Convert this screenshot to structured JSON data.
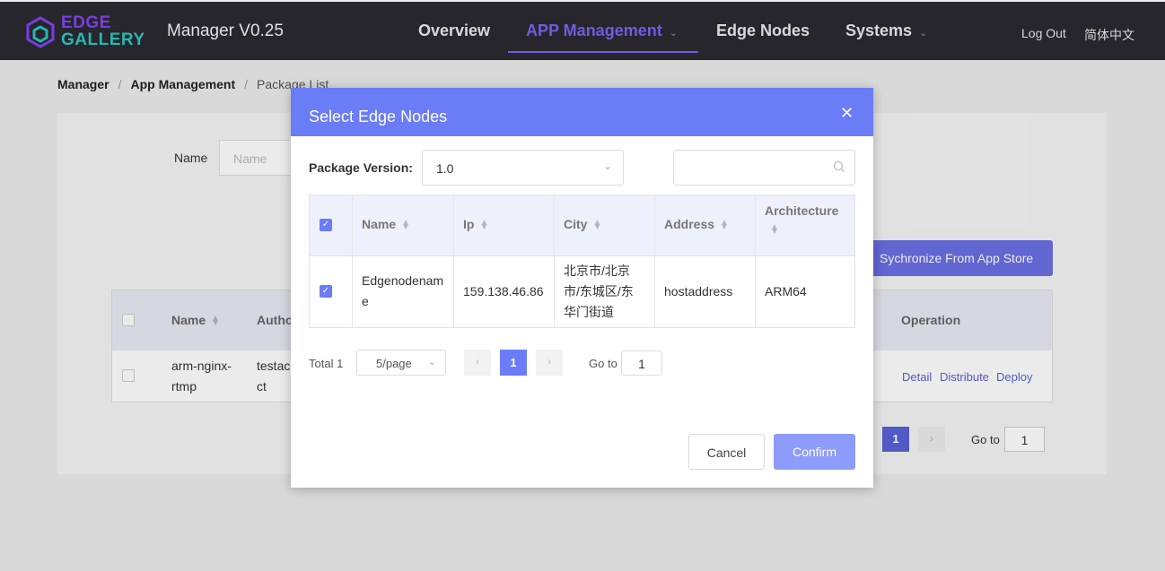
{
  "header": {
    "logo_line1": "EDGE",
    "logo_line2": "GALLERY",
    "app_title": "Manager V0.25",
    "nav": [
      {
        "label": "Overview"
      },
      {
        "label": "APP Management"
      },
      {
        "label": "Edge Nodes"
      },
      {
        "label": "Systems"
      }
    ],
    "logout": "Log Out",
    "language": "简体中文"
  },
  "breadcrumb": {
    "items": [
      "Manager",
      "App Management",
      "Package List"
    ]
  },
  "background": {
    "name_label": "Name",
    "name_placeholder": "Name",
    "sync_button": "Sychronize From App Store",
    "columns": [
      "Name",
      "Autho",
      "Operation"
    ],
    "row": {
      "name": "arm-nginx-rtmp",
      "author": "testacct",
      "ops": [
        "Detail",
        "Distribute",
        "Deploy"
      ]
    },
    "page_current": "1",
    "goto_label": "Go to",
    "goto_value": "1"
  },
  "modal": {
    "title": "Select Edge Nodes",
    "package_version_label": "Package Version:",
    "package_version_value": "1.0",
    "columns": [
      "Name",
      "Ip",
      "City",
      "Address",
      "Architecture"
    ],
    "rows": [
      {
        "name": "Edgenodename",
        "ip": "159.138.46.86",
        "city": "北京市/北京市/东城区/东华门街道",
        "address": "hostaddress",
        "architecture": "ARM64",
        "checked": true
      }
    ],
    "total": "Total 1",
    "page_size": "5/page",
    "page_current": "1",
    "goto_label": "Go to",
    "goto_value": "1",
    "cancel": "Cancel",
    "confirm": "Confirm"
  },
  "colors": {
    "nav_bg": "#26262c",
    "accent": "#6b7cf7",
    "nav_active": "#6f5ce0",
    "logo_purple": "#7a3ee0",
    "logo_teal": "#29b7b2"
  }
}
